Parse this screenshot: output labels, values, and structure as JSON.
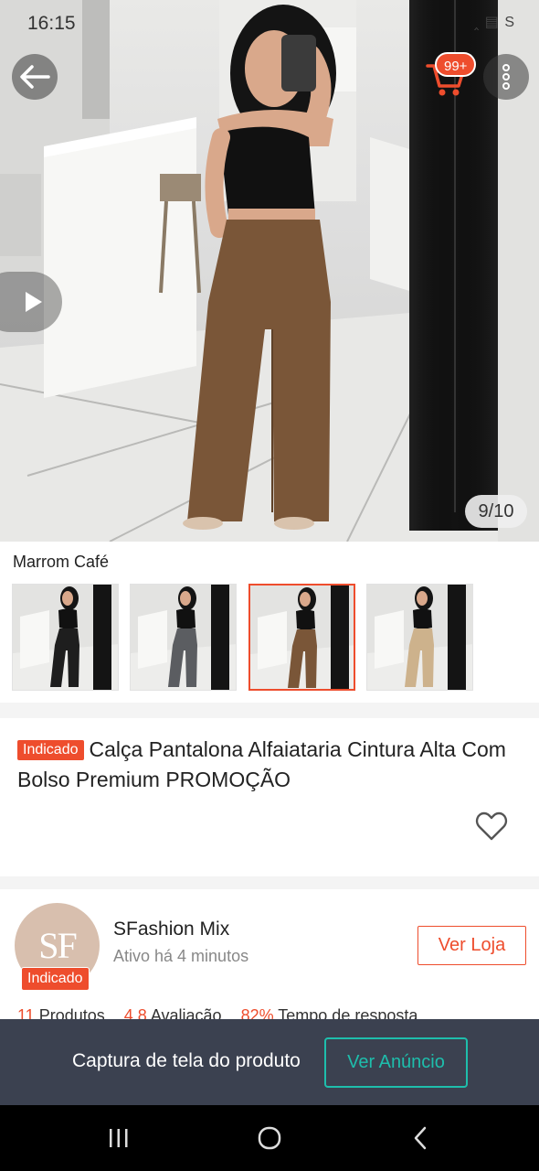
{
  "status_bar": {
    "time": "16:15",
    "right": "‸ ▤ S"
  },
  "header": {
    "cart_badge": "99+",
    "icons": [
      "back-arrow-icon",
      "cart-icon",
      "more-vertical-icon"
    ]
  },
  "gallery": {
    "counter": "9/10",
    "current": 9,
    "total": 10,
    "play_icon": "play-icon"
  },
  "variations": {
    "selected_label": "Marrom Café",
    "options": [
      {
        "name": "preto",
        "pants_color": "#1e1e1e"
      },
      {
        "name": "cinza",
        "pants_color": "#5b5d61"
      },
      {
        "name": "marrom",
        "pants_color": "#7a5638"
      },
      {
        "name": "bege",
        "pants_color": "#cdb28c"
      }
    ],
    "selected_index": 2
  },
  "product": {
    "tag": "Indicado",
    "title": "Calça Pantalona Alfaiataria Cintura Alta Com Bolso Premium PROMOÇÃO",
    "favorite_icon": "heart-icon"
  },
  "shop": {
    "avatar_text": "SF",
    "tag": "Indicado",
    "name": "SFashion Mix",
    "status": "Ativo há 4 minutos",
    "visit_label": "Ver Loja",
    "stats": [
      {
        "value": "11",
        "label": "Produtos"
      },
      {
        "value": "4.8",
        "label": "Avaliação"
      },
      {
        "value": "82%",
        "label": "Tempo de resposta"
      }
    ]
  },
  "capture_bar": {
    "text": "Captura de tela do produto",
    "button_label": "Ver Anúncio"
  },
  "nav": {
    "icons": [
      "recent-apps-icon",
      "home-icon",
      "back-icon"
    ]
  },
  "colors": {
    "accent": "#ee4d2d",
    "teal": "#1ebeac",
    "capture_bg": "#3b4150"
  }
}
